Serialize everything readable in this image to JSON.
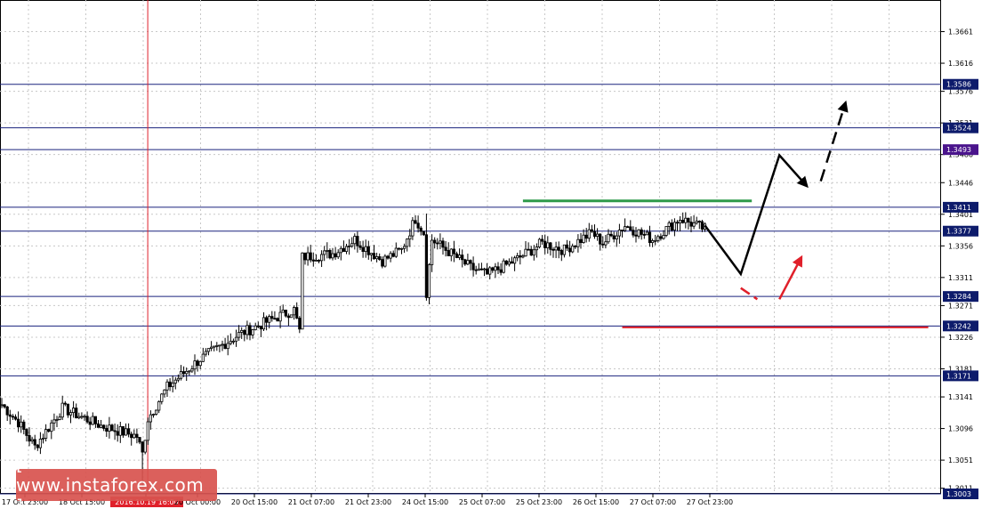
{
  "watermark": {
    "text": "[ www.instaforex.com ]"
  },
  "colors": {
    "grid": "#c8c8c8",
    "level_line": "#1a237e",
    "level_badge": "#0d1b6b",
    "level_badge_highlight": "#4a148c",
    "candle": "#000000",
    "green_line": "#2e9a4a",
    "red_line": "#e0202a",
    "vline": "#e0202a"
  },
  "chart_data": {
    "type": "candlestick",
    "instrument_scale": "price",
    "ylim": [
      1.3003,
      1.3706
    ],
    "y_ticks": [
      "1.3661",
      "1.3616",
      "1.3576",
      "1.3531",
      "1.3486",
      "1.3446",
      "1.3401",
      "1.3356",
      "1.3311",
      "1.3271",
      "1.3226",
      "1.3181",
      "1.3141",
      "1.3096",
      "1.3051",
      "1.3011"
    ],
    "x_ticks": [
      {
        "label": "17 Oct 23:00",
        "highlight": false
      },
      {
        "label": "18 Oct 15:00",
        "highlight": false
      },
      {
        "label": "2016.10.19 16:00",
        "highlight": true
      },
      {
        "label": "20 Oct 00:00",
        "highlight": false
      },
      {
        "label": "20 Oct 15:00",
        "highlight": false
      },
      {
        "label": "21 Oct 07:00",
        "highlight": false
      },
      {
        "label": "21 Oct 23:00",
        "highlight": false
      },
      {
        "label": "24 Oct 15:00",
        "highlight": false
      },
      {
        "label": "25 Oct 07:00",
        "highlight": false
      },
      {
        "label": "25 Oct 23:00",
        "highlight": false
      },
      {
        "label": "26 Oct 15:00",
        "highlight": false
      },
      {
        "label": "27 Oct 07:00",
        "highlight": false
      },
      {
        "label": "27 Oct 23:00",
        "highlight": false
      }
    ],
    "levels": [
      {
        "value": 1.3586,
        "label": "1.3586",
        "highlight": false
      },
      {
        "value": 1.3524,
        "label": "1.3524",
        "highlight": false
      },
      {
        "value": 1.3493,
        "label": "1.3493",
        "highlight": true
      },
      {
        "value": 1.3411,
        "label": "1.3411",
        "highlight": false
      },
      {
        "value": 1.3377,
        "label": "1.3377",
        "highlight": false
      },
      {
        "value": 1.3284,
        "label": "1.3284",
        "highlight": false
      },
      {
        "value": 1.3242,
        "label": "1.3242",
        "highlight": false
      },
      {
        "value": 1.3171,
        "label": "1.3171",
        "highlight": false
      },
      {
        "value": 1.3003,
        "label": "1.3003",
        "highlight": false
      }
    ],
    "anchors": [
      {
        "price": 1.313,
        "i": 0
      },
      {
        "price": 1.3105,
        "i": 6
      },
      {
        "price": 1.307,
        "i": 12
      },
      {
        "price": 1.3125,
        "i": 22
      },
      {
        "price": 1.31,
        "i": 36
      },
      {
        "price": 1.3085,
        "i": 49
      },
      {
        "price": 1.306,
        "i": 51
      },
      {
        "price": 1.311,
        "i": 53
      },
      {
        "price": 1.3155,
        "i": 60
      },
      {
        "price": 1.3195,
        "i": 72
      },
      {
        "price": 1.323,
        "i": 86
      },
      {
        "price": 1.3255,
        "i": 100
      },
      {
        "price": 1.3265,
        "i": 106
      },
      {
        "price": 1.3235,
        "i": 108
      },
      {
        "price": 1.334,
        "i": 109
      },
      {
        "price": 1.3345,
        "i": 120
      },
      {
        "price": 1.3365,
        "i": 128
      },
      {
        "price": 1.3335,
        "i": 138
      },
      {
        "price": 1.335,
        "i": 145
      },
      {
        "price": 1.3395,
        "i": 150
      },
      {
        "price": 1.3375,
        "i": 153
      },
      {
        "price": 1.329,
        "i": 154
      },
      {
        "price": 1.3365,
        "i": 156
      },
      {
        "price": 1.3325,
        "i": 170
      },
      {
        "price": 1.3315,
        "i": 176
      },
      {
        "price": 1.3335,
        "i": 186
      },
      {
        "price": 1.336,
        "i": 196
      },
      {
        "price": 1.335,
        "i": 204
      },
      {
        "price": 1.3375,
        "i": 214
      },
      {
        "price": 1.336,
        "i": 218
      },
      {
        "price": 1.3385,
        "i": 226
      },
      {
        "price": 1.3365,
        "i": 236
      },
      {
        "price": 1.3395,
        "i": 246
      },
      {
        "price": 1.338,
        "i": 255
      }
    ],
    "candle_count": 256,
    "forecast": {
      "black_path": [
        {
          "i": 255,
          "price": 1.3385
        },
        {
          "i": 268,
          "price": 1.3316
        },
        {
          "i": 282,
          "price": 1.3485
        },
        {
          "i": 292,
          "price": 1.3441
        }
      ],
      "black_dashed": [
        {
          "i": 297,
          "price": 1.3448
        },
        {
          "i": 306,
          "price": 1.356
        }
      ],
      "red_dashed": [
        {
          "i": 268,
          "price": 1.3296
        },
        {
          "i": 274,
          "price": 1.328
        }
      ],
      "red_arrow": [
        {
          "i": 282,
          "price": 1.328
        },
        {
          "i": 290,
          "price": 1.334
        }
      ],
      "green_line": {
        "price": 1.342,
        "i_start": 189,
        "i_end": 272
      },
      "red_line": {
        "price": 1.324,
        "i_start": 225,
        "i_end": 336
      }
    },
    "highlight_index": 51
  }
}
